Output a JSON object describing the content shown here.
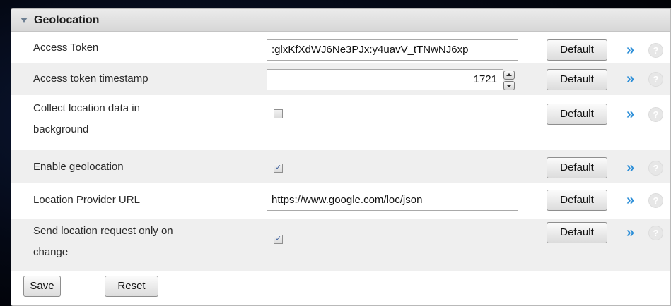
{
  "section": {
    "title": "Geolocation"
  },
  "rows": [
    {
      "label": "Access Token",
      "value": ":glxKfXdWJ6Ne3PJx:y4uavV_tTNwNJ6xp",
      "default_label": "Default"
    },
    {
      "label": "Access token timestamp",
      "value": "1721",
      "default_label": "Default"
    },
    {
      "label_line1": "Collect location data in",
      "label_line2": "background",
      "checked": false,
      "default_label": "Default"
    },
    {
      "label": "Enable geolocation",
      "checked": true,
      "default_label": "Default"
    },
    {
      "label": "Location Provider URL",
      "value": "https://www.google.com/loc/json",
      "default_label": "Default"
    },
    {
      "label_line1": "Send location request only on",
      "label_line2": "change",
      "checked": true,
      "default_label": "Default"
    }
  ],
  "icons": {
    "more": "»",
    "help": "?"
  },
  "footer": {
    "save_label": "Save",
    "reset_label": "Reset"
  }
}
